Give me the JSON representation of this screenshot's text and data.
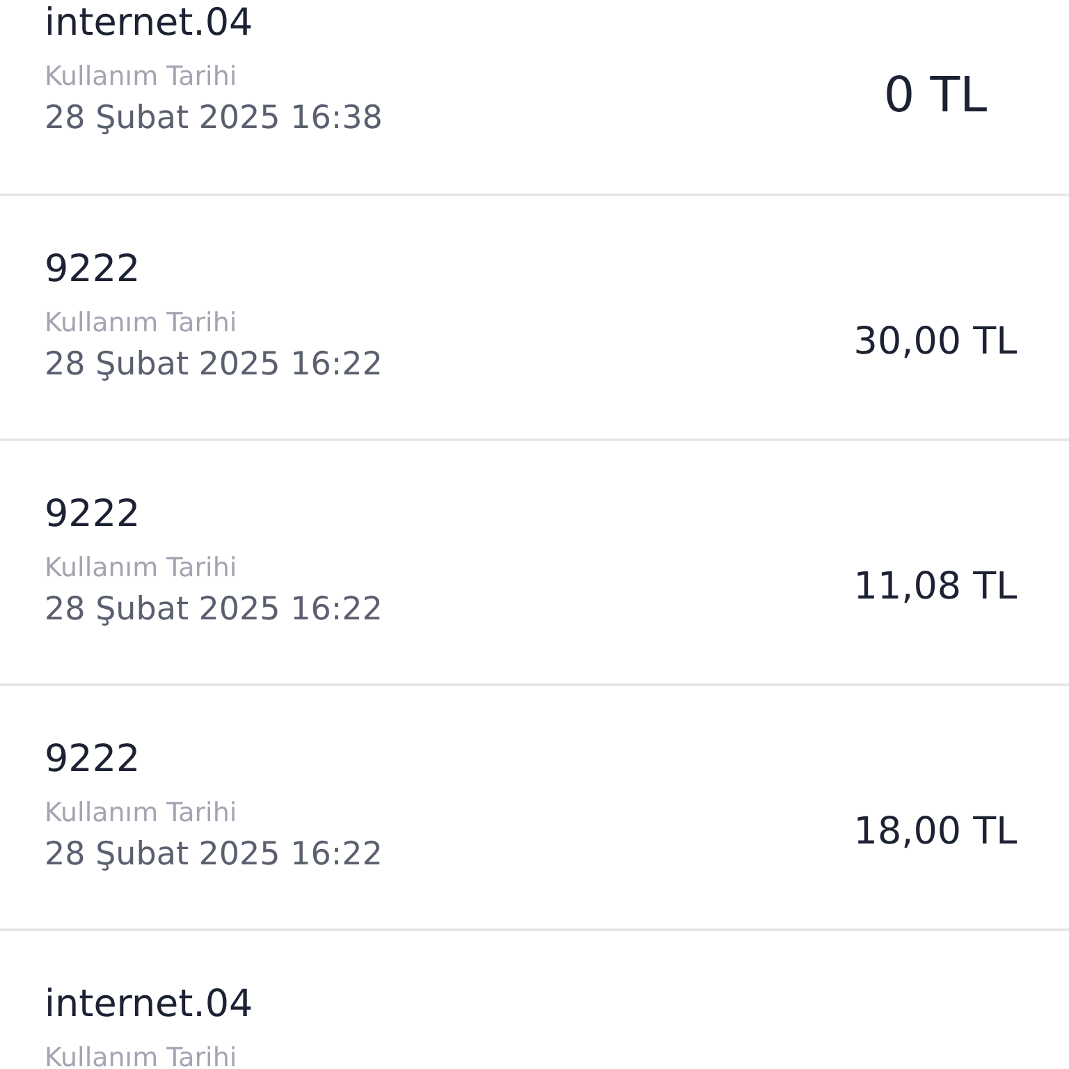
{
  "usages": [
    {
      "title": "internet.04",
      "date_label": "Kullanım Tarihi",
      "date": "28 Şubat 2025 16:38",
      "amount": "0 TL",
      "kind": "free"
    },
    {
      "title": "9222",
      "date_label": "Kullanım Tarihi",
      "date": "28 Şubat 2025 16:22",
      "amount": "30,00 TL",
      "kind": "charge"
    },
    {
      "title": "9222",
      "date_label": "Kullanım Tarihi",
      "date": "28 Şubat 2025 16:22",
      "amount": "11,08 TL",
      "kind": "charge"
    },
    {
      "title": "9222",
      "date_label": "Kullanım Tarihi",
      "date": "28 Şubat 2025 16:22",
      "amount": "18,00 TL",
      "kind": "charge"
    },
    {
      "title": "internet.04",
      "date_label": "Kullanım Tarihi"
    }
  ]
}
